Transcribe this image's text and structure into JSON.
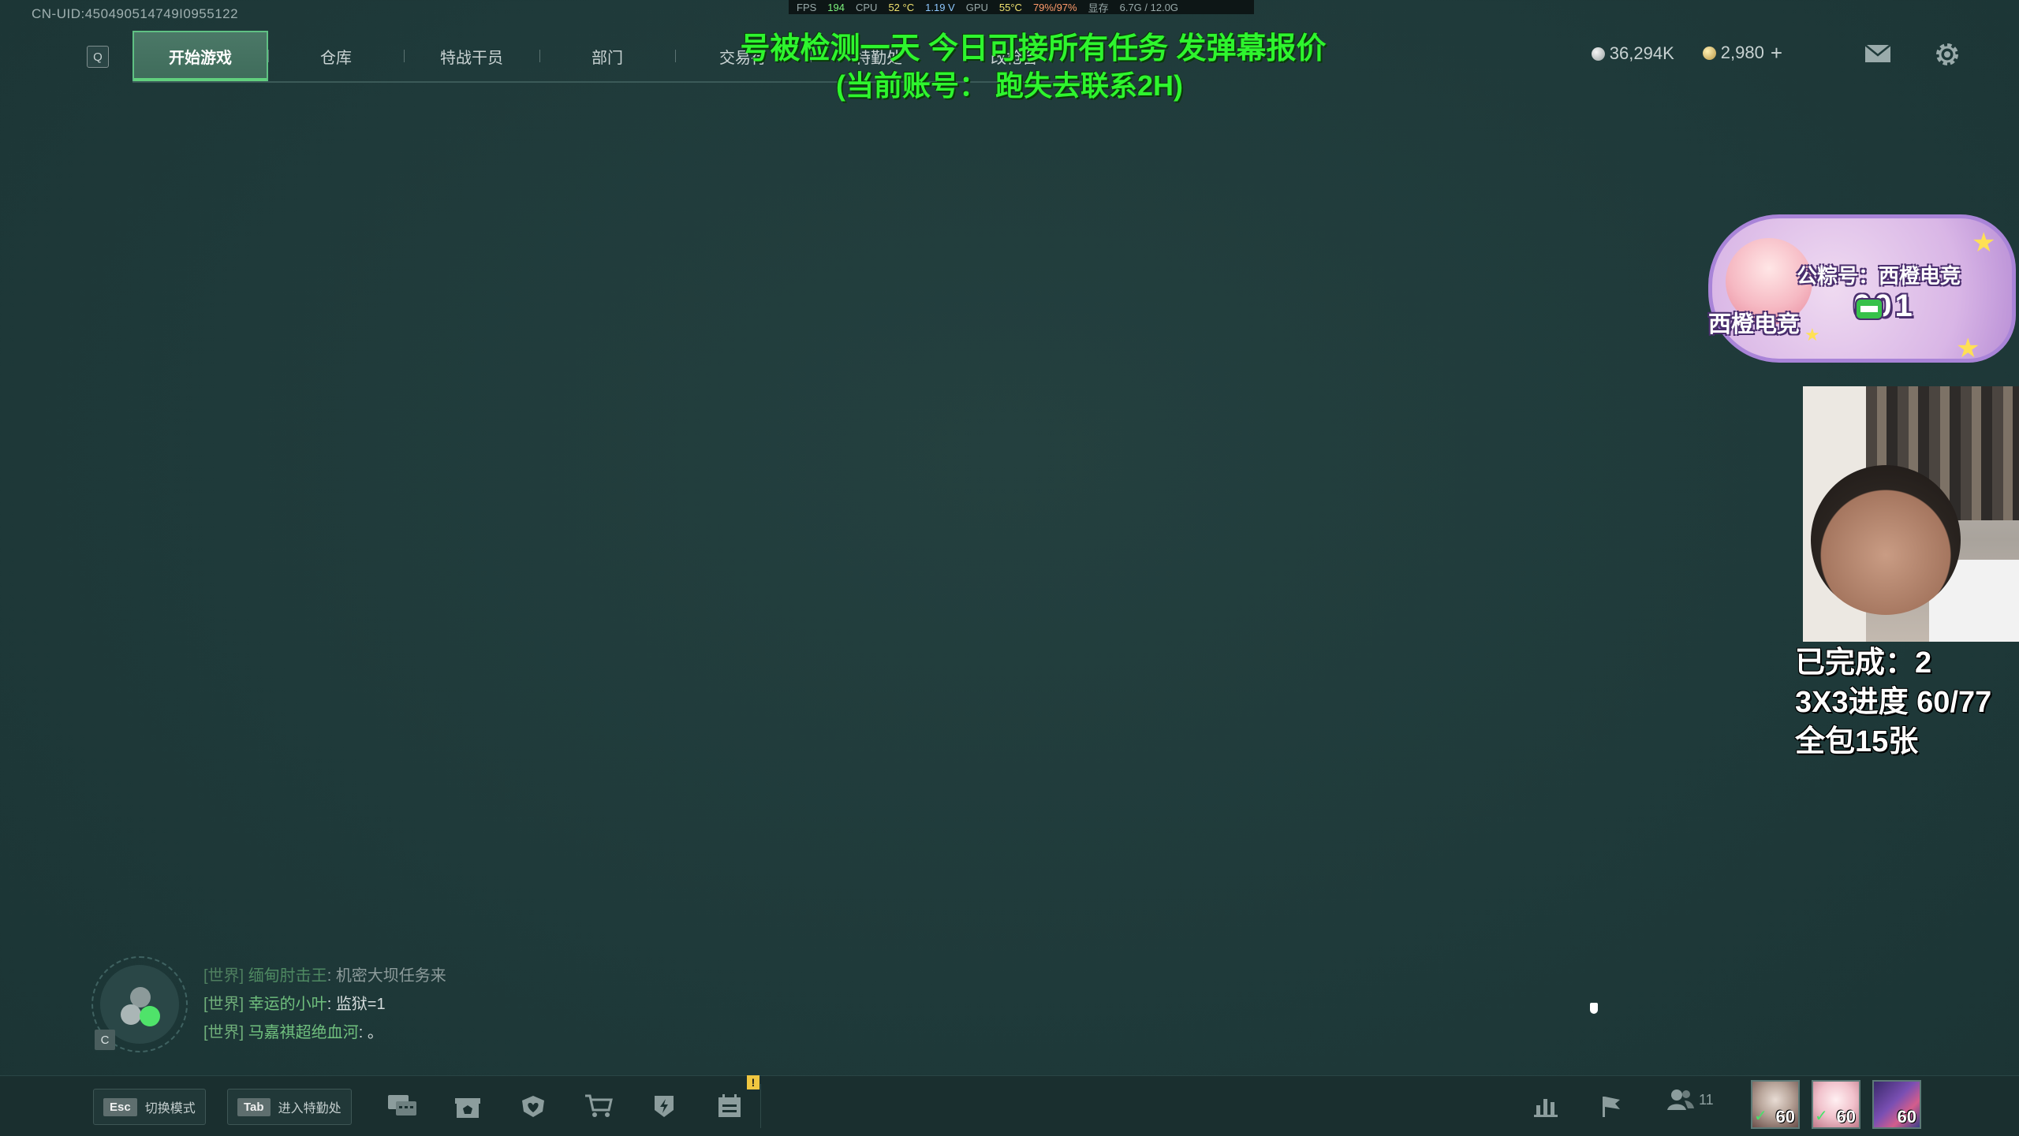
{
  "uid": "CN-UID:450490514749I0955122",
  "perf": {
    "fps_label": "FPS",
    "fps": "194",
    "cpu_label": "CPU",
    "cpu_temp": "52 °C",
    "cpu_volt": "1.19 V",
    "gpu_label": "GPU",
    "gpu_temp": "55°C",
    "gpu_usage": "79%/97%",
    "vram_label": "显存",
    "vram": "6.7G / 12.0G"
  },
  "hotkey_q": "Q",
  "tabs": [
    "开始游戏",
    "仓库",
    "特战干员",
    "部门",
    "交易行",
    "特勤处",
    "改枪台"
  ],
  "active_tab": 0,
  "overlay": {
    "line1": "号被检测一天 今日可接所有任务 发弹幕报价",
    "line2": "(当前账号：  跑失去联系2H)"
  },
  "currency": {
    "silver": "36,294K",
    "gold": "2,980"
  },
  "badge": {
    "name": "西橙电竞",
    "public_account": "公粽号：西橙电竞",
    "code": "001"
  },
  "stats": {
    "line1": "已完成：2",
    "line2": "3X3进度 60/77",
    "line3": "全包15张"
  },
  "voice_key": "C",
  "chat": [
    {
      "channel": "[世界]",
      "user": "缅甸肘击王",
      "message": "机密大坝任务来"
    },
    {
      "channel": "[世界]",
      "user": "幸运的小叶",
      "message": "监狱=1"
    },
    {
      "channel": "[世界]",
      "user": "马嘉祺超绝血河",
      "message": "。"
    }
  ],
  "bottom": {
    "esc_key": "Esc",
    "esc_label": "切换模式",
    "tab_key": "Tab",
    "tab_label": "进入特勤处",
    "warn": "!",
    "friends_count": "11"
  },
  "operators": [
    {
      "level": "60",
      "checked": true
    },
    {
      "level": "60",
      "checked": true
    },
    {
      "level": "60",
      "checked": false
    }
  ]
}
